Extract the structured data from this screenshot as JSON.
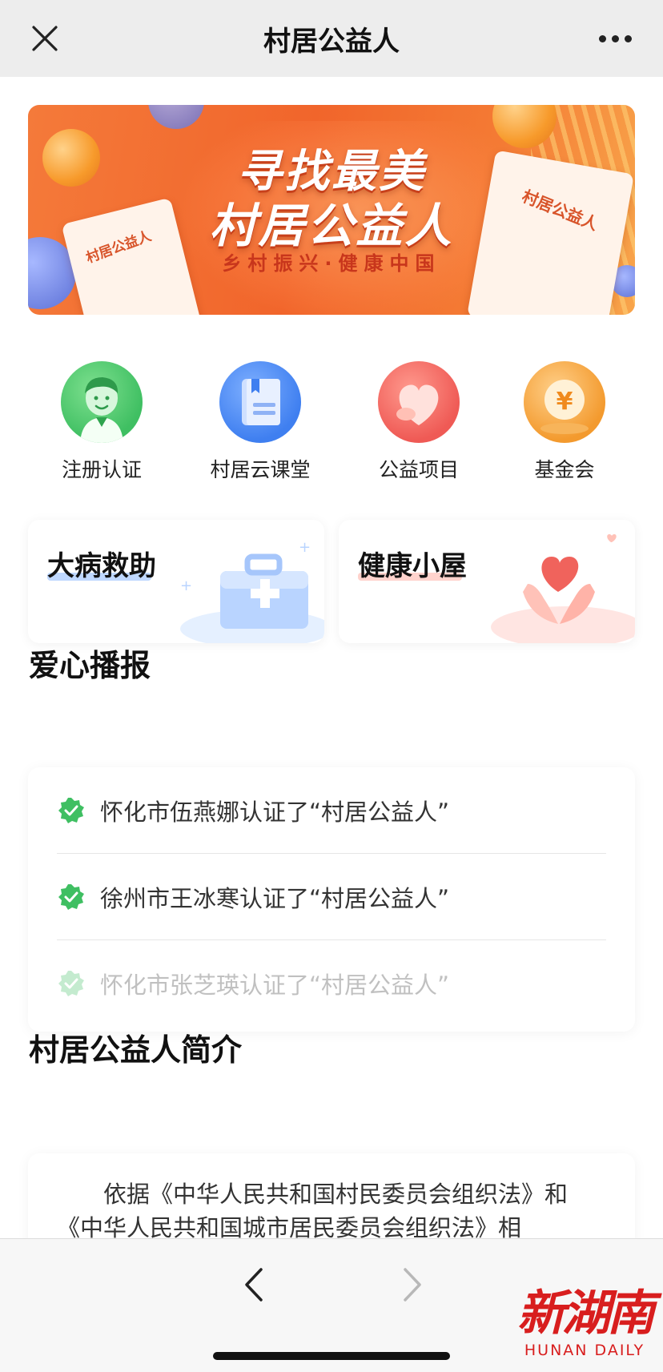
{
  "navbar": {
    "title": "村居公益人",
    "close_icon": "close-icon",
    "more_icon": "more-icon"
  },
  "banner": {
    "title_line1": "寻找最美",
    "title_line2": "村居公益人",
    "subtitle": "乡村振兴·健康中国",
    "certificate_label": "村居公益人"
  },
  "quick_menu": [
    {
      "label": "注册认证",
      "icon": "user-avatar-icon",
      "color": "#3fbf62"
    },
    {
      "label": "村居云课堂",
      "icon": "book-icon",
      "color": "#3f7ff0"
    },
    {
      "label": "公益项目",
      "icon": "heart-icon",
      "color": "#ef5a55"
    },
    {
      "label": "基金会",
      "icon": "yuan-coin-icon",
      "color": "#f39a2e"
    }
  ],
  "cards": [
    {
      "title": "大病救助",
      "icon": "medical-kit-icon"
    },
    {
      "title": "健康小屋",
      "icon": "hands-heart-icon"
    }
  ],
  "broadcast": {
    "title": "爱心播报",
    "items": [
      "怀化市伍燕娜认证了“村居公益人”",
      "徐州市王冰寒认证了“村居公益人”",
      "怀化市张芝瑛认证了“村居公益人”"
    ]
  },
  "intro": {
    "title": "村居公益人简介",
    "text": "依据《中华人民共和国村民委员会组织法》和《中华人民共和国城市居民委员会组织法》相"
  },
  "toolbar": {
    "back_icon": "chevron-left-icon",
    "forward_icon": "chevron-right-icon"
  },
  "watermark": {
    "logo": "新湖南",
    "sub": "HUNAN DAILY"
  },
  "colors": {
    "accent_green": "#3fbf62",
    "banner_orange": "#f1652b"
  }
}
